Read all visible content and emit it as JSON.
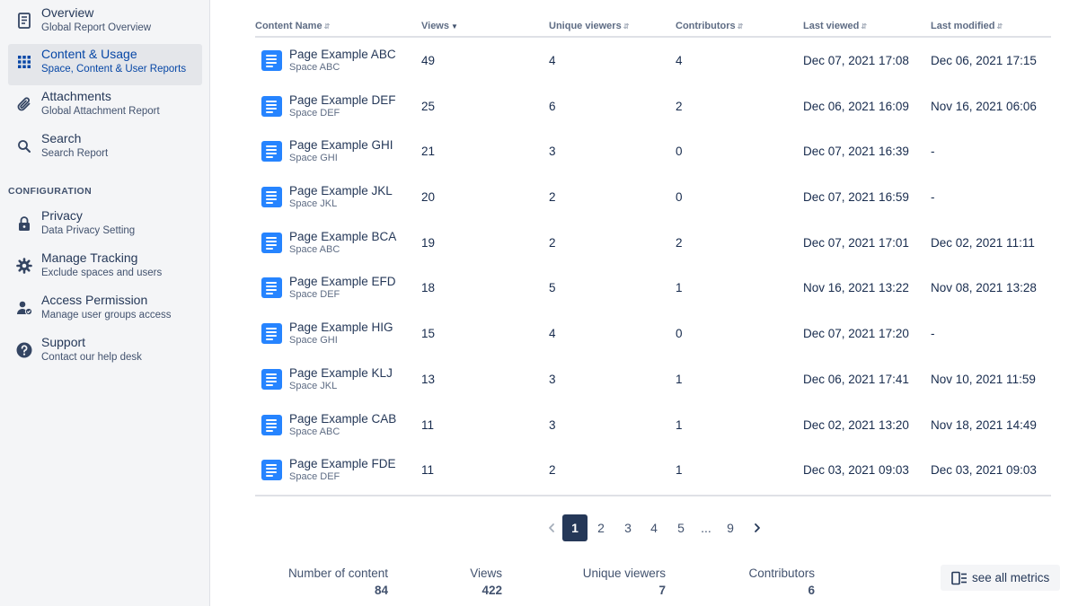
{
  "sidebar": {
    "items": [
      {
        "label": "Overview",
        "sub": "Global Report Overview",
        "icon": "document-icon"
      },
      {
        "label": "Content & Usage",
        "sub": "Space, Content & User Reports",
        "icon": "grid-icon"
      },
      {
        "label": "Attachments",
        "sub": "Global Attachment Report",
        "icon": "paperclip-icon"
      },
      {
        "label": "Search",
        "sub": "Search Report",
        "icon": "search-icon"
      }
    ],
    "section_header": "CONFIGURATION",
    "config_items": [
      {
        "label": "Privacy",
        "sub": "Data Privacy Setting",
        "icon": "lock-icon"
      },
      {
        "label": "Manage Tracking",
        "sub": "Exclude spaces and users",
        "icon": "gear-icon"
      },
      {
        "label": "Access Permission",
        "sub": "Manage user groups access",
        "icon": "user-check-icon"
      },
      {
        "label": "Support",
        "sub": "Contact our help desk",
        "icon": "help-icon"
      }
    ]
  },
  "table": {
    "columns": [
      "Content Name",
      "Views",
      "Unique viewers",
      "Contributors",
      "Last viewed",
      "Last modified"
    ],
    "sort_column": "Views",
    "rows": [
      {
        "name": "Page Example ABC",
        "space": "Space ABC",
        "views": "49",
        "unique": "4",
        "contributors": "4",
        "last_viewed": "Dec 07, 2021 17:08",
        "last_modified": "Dec 06, 2021 17:15"
      },
      {
        "name": "Page Example DEF",
        "space": "Space DEF",
        "views": "25",
        "unique": "6",
        "contributors": "2",
        "last_viewed": "Dec 06, 2021 16:09",
        "last_modified": "Nov 16, 2021 06:06"
      },
      {
        "name": "Page Example GHI",
        "space": "Space GHI",
        "views": "21",
        "unique": "3",
        "contributors": "0",
        "last_viewed": "Dec 07, 2021 16:39",
        "last_modified": "-"
      },
      {
        "name": "Page Example JKL",
        "space": "Space JKL",
        "views": "20",
        "unique": "2",
        "contributors": "0",
        "last_viewed": "Dec 07, 2021 16:59",
        "last_modified": "-"
      },
      {
        "name": "Page Example BCA",
        "space": "Space ABC",
        "views": "19",
        "unique": "2",
        "contributors": "2",
        "last_viewed": "Dec 07, 2021 17:01",
        "last_modified": "Dec 02, 2021 11:11"
      },
      {
        "name": "Page Example EFD",
        "space": "Space DEF",
        "views": "18",
        "unique": "5",
        "contributors": "1",
        "last_viewed": "Nov 16, 2021 13:22",
        "last_modified": "Nov 08, 2021 13:28"
      },
      {
        "name": "Page Example HIG",
        "space": "Space GHI",
        "views": "15",
        "unique": "4",
        "contributors": "0",
        "last_viewed": "Dec 07, 2021 17:20",
        "last_modified": "-"
      },
      {
        "name": "Page Example KLJ",
        "space": "Space JKL",
        "views": "13",
        "unique": "3",
        "contributors": "1",
        "last_viewed": "Dec 06, 2021 17:41",
        "last_modified": "Nov 10, 2021 11:59"
      },
      {
        "name": "Page Example CAB",
        "space": "Space ABC",
        "views": "11",
        "unique": "3",
        "contributors": "1",
        "last_viewed": "Dec 02, 2021 13:20",
        "last_modified": "Nov 18, 2021 14:49"
      },
      {
        "name": "Page Example FDE",
        "space": "Space DEF",
        "views": "11",
        "unique": "2",
        "contributors": "1",
        "last_viewed": "Dec 03, 2021 09:03",
        "last_modified": "Dec 03, 2021 09:03"
      }
    ]
  },
  "pagination": {
    "current": "1",
    "pages": [
      "1",
      "2",
      "3",
      "4",
      "5",
      "...",
      "9"
    ]
  },
  "summary": {
    "metrics": [
      {
        "label": "Number of content",
        "value": "84"
      },
      {
        "label": "Views",
        "value": "422"
      },
      {
        "label": "Unique viewers",
        "value": "7"
      },
      {
        "label": "Contributors",
        "value": "6"
      }
    ],
    "see_all_label": "see all metrics"
  },
  "colors": {
    "accent": "#0747a6",
    "doc_icon": "#2684ff",
    "active_bg": "#e4e6ea",
    "page_current": "#253858"
  }
}
